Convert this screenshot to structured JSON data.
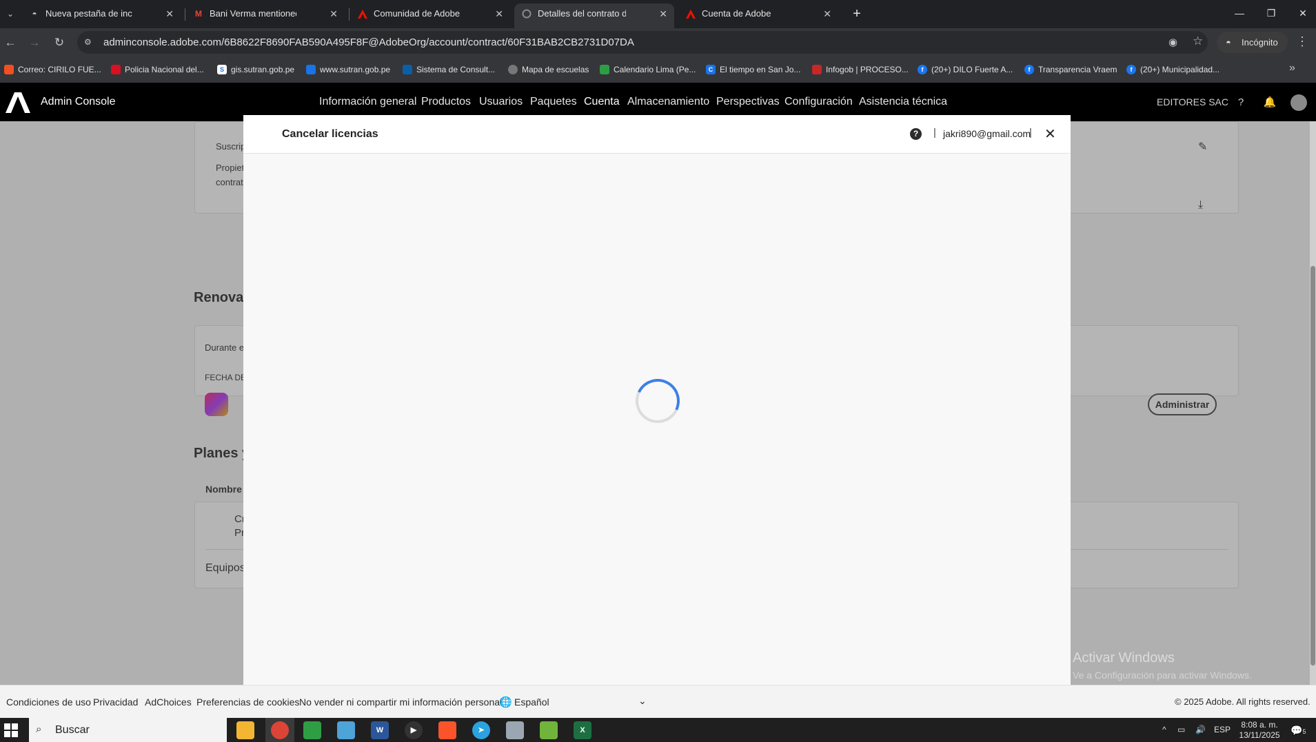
{
  "browser": {
    "tabs": [
      {
        "title": "Nueva pestaña de incógnito",
        "icon": "incognito-icon"
      },
      {
        "title": "Bani Verma mentioned you in A",
        "icon": "gmail-icon"
      },
      {
        "title": "Comunidad de Adobe | Inspirac",
        "icon": "adobe-icon"
      },
      {
        "title": "Detalles del contrato de cuenta",
        "icon": "loading-icon"
      },
      {
        "title": "Cuenta de Adobe",
        "icon": "adobe-icon"
      }
    ],
    "url": "adminconsole.adobe.com/6B8622F8690FAB590A495F8F@AdobeOrg/account/contract/60F31BAB2CB2731D07DA",
    "incognito_label": "Incógnito",
    "bookmarks": [
      {
        "label": "Correo: CIRILO FUE...",
        "color": "#f25022"
      },
      {
        "label": "Policia Nacional del...",
        "color": "#d91023"
      },
      {
        "label": "gis.sutran.gob.pe",
        "color": "#1a73e8"
      },
      {
        "label": "www.sutran.gob.pe",
        "color": "#1a73e8"
      },
      {
        "label": "Sistema de Consult...",
        "color": "#0b5ea8"
      },
      {
        "label": "Mapa de escuelas",
        "color": "#777777"
      },
      {
        "label": "Calendario Lima (Pe...",
        "color": "#2e9e44"
      },
      {
        "label": "El tiempo en San Jo...",
        "color": "#1a73e8"
      },
      {
        "label": "Infogob | PROCESO...",
        "color": "#c62828"
      },
      {
        "label": "(20+) DILO Fuerte A...",
        "color": "#1877f2"
      },
      {
        "label": "Transparencia Vraem",
        "color": "#1877f2"
      },
      {
        "label": "(20+) Municipalidad...",
        "color": "#1877f2"
      }
    ]
  },
  "header": {
    "app_title": "Admin Console",
    "nav": [
      "Información general",
      "Productos",
      "Usuarios",
      "Paquetes",
      "Cuenta",
      "Almacenamiento",
      "Perspectivas",
      "Configuración",
      "Asistencia técnica"
    ],
    "active_nav": "Cuenta",
    "org_name": "EDITORES SAC"
  },
  "background": {
    "subscription_label": "Suscrip",
    "owner_label_1": "Propiet",
    "owner_label_2": "contrat",
    "renewal_heading": "Renovac",
    "renewal_text": "Durante e",
    "renewal_date_label": "FECHA DE",
    "plans_heading": "Planes y",
    "name_column": "Nombre",
    "product_line1": "Cr",
    "product_line2": "Pr",
    "teams_label": "Equipos",
    "manage_button": "Administrar"
  },
  "modal": {
    "title": "Cancelar licencias",
    "help_glyph": "?",
    "pipe": "|",
    "email": "jakri890@gmail.com",
    "loading": true
  },
  "footer": {
    "links": [
      "Condiciones de uso",
      "Privacidad",
      "AdChoices",
      "Preferencias de cookies",
      "No vender ni compartir mi información personal"
    ],
    "language": "Español",
    "copyright": "© 2025 Adobe. All rights reserved."
  },
  "watermark": {
    "line1": "Activar Windows",
    "line2": "Ve a Configuración para activar Windows."
  },
  "taskbar": {
    "search_placeholder": "Buscar",
    "language": "ESP",
    "time": "8:08 a. m.",
    "date": "13/11/2025",
    "notifications": "5"
  }
}
